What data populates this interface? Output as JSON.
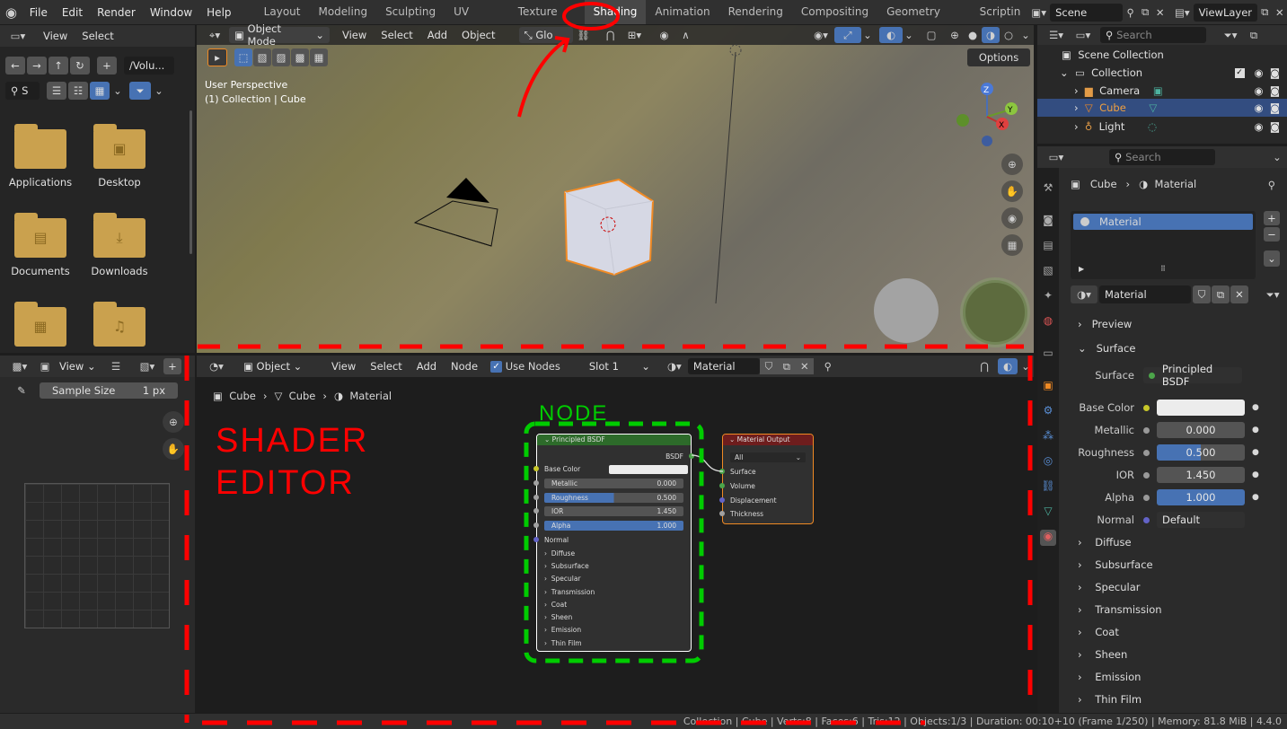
{
  "topbar": {
    "menus": [
      "File",
      "Edit",
      "Render",
      "Window",
      "Help"
    ],
    "workspaces": [
      "Layout",
      "Modeling",
      "Sculpting",
      "UV Editing",
      "Texture Paint",
      "Shading",
      "Animation",
      "Rendering",
      "Compositing",
      "Geometry Nodes",
      "Scriptin"
    ],
    "active_workspace": "Shading",
    "scene": "Scene",
    "view_layer": "ViewLayer"
  },
  "file_browser": {
    "menus": [
      "View",
      "Select"
    ],
    "path": "/Volu...",
    "search_placeholder": "S",
    "folders": [
      "Applications",
      "Desktop",
      "Documents",
      "Downloads",
      "",
      ""
    ]
  },
  "viewport": {
    "mode": "Object Mode",
    "menus": [
      "View",
      "Select",
      "Add",
      "Object"
    ],
    "transform": "Glo",
    "options": "Options",
    "info_line1": "User Perspective",
    "info_line2": "(1) Collection | Cube",
    "gizmo": {
      "z": "Z",
      "y": "Y",
      "x": "X"
    }
  },
  "image_editor": {
    "menu": "View",
    "sample_label": "Sample Size",
    "sample_value": "1 px"
  },
  "shader_editor": {
    "object": "Object",
    "menus": [
      "View",
      "Select",
      "Add",
      "Node"
    ],
    "use_nodes": "Use Nodes",
    "slot": "Slot 1",
    "material": "Material",
    "breadcrumb": [
      "Cube",
      "Cube",
      "Material"
    ]
  },
  "principled_node": {
    "title": "Principled BSDF",
    "output": "BSDF",
    "base_color": "Base Color",
    "metallic": {
      "label": "Metallic",
      "value": "0.000"
    },
    "roughness": {
      "label": "Roughness",
      "value": "0.500"
    },
    "ior": {
      "label": "IOR",
      "value": "1.450"
    },
    "alpha": {
      "label": "Alpha",
      "value": "1.000"
    },
    "normal": "Normal",
    "panels": [
      "Diffuse",
      "Subsurface",
      "Specular",
      "Transmission",
      "Coat",
      "Sheen",
      "Emission",
      "Thin Film"
    ]
  },
  "output_node": {
    "title": "Material Output",
    "target": "All",
    "inputs": [
      "Surface",
      "Volume",
      "Displacement",
      "Thickness"
    ]
  },
  "annotations": {
    "node": "NODE",
    "shader1": "SHADER",
    "shader2": "EDITOR"
  },
  "outliner": {
    "search_placeholder": "Search",
    "scene_collection": "Scene Collection",
    "collection": "Collection",
    "items": [
      "Camera",
      "Cube",
      "Light"
    ]
  },
  "properties": {
    "search_placeholder": "Search",
    "breadcrumb_object": "Cube",
    "breadcrumb_material": "Material",
    "slot_item": "Material",
    "material_name": "Material",
    "preview": "Preview",
    "surface_header": "Surface",
    "surface_label": "Surface",
    "surface_value": "Principled BSDF",
    "base_color": "Base Color",
    "metallic": {
      "label": "Metallic",
      "value": "0.000"
    },
    "roughness": {
      "label": "Roughness",
      "value": "0.500"
    },
    "ior": {
      "label": "IOR",
      "value": "1.450"
    },
    "alpha": {
      "label": "Alpha",
      "value": "1.000"
    },
    "normal": {
      "label": "Normal",
      "value": "Default"
    },
    "panels": [
      "Diffuse",
      "Subsurface",
      "Specular",
      "Transmission",
      "Coat",
      "Sheen",
      "Emission",
      "Thin Film"
    ]
  },
  "statusbar": {
    "text": "Collection | Cube | Verts:8 | Faces:6 | Tris:12 | Objects:1/3 | Duration: 00:10+10 (Frame 1/250) | Memory: 81.8 MiB | 4.4.0"
  },
  "colors": {
    "accent": "#4772b3",
    "annotation": "#ff0000",
    "node_annotation": "#00cc00",
    "selection": "#f08a24"
  }
}
